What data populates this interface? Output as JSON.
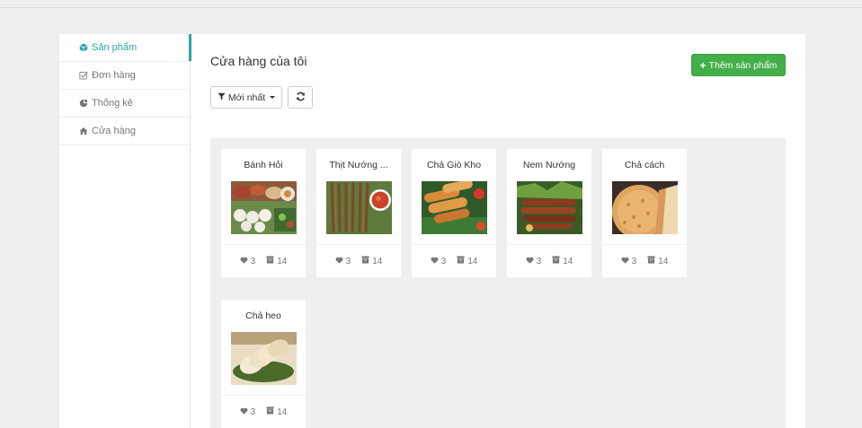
{
  "sidebar": {
    "items": [
      {
        "label": "Sản phẩm",
        "icon": "cube-icon",
        "active": true
      },
      {
        "label": "Đơn hàng",
        "icon": "checkbox-icon",
        "active": false
      },
      {
        "label": "Thống kê",
        "icon": "pie-chart-icon",
        "active": false
      },
      {
        "label": "Cửa hàng",
        "icon": "home-icon",
        "active": false
      }
    ]
  },
  "main": {
    "title": "Cửa hàng của tôi",
    "add_button": "Thêm sản phẩm",
    "filter": {
      "label": "Mới nhất",
      "icon": "filter-icon"
    },
    "refresh_icon": "refresh-icon"
  },
  "products": [
    {
      "name": "Bánh Hỏi",
      "likes": "3",
      "stock": "14"
    },
    {
      "name": "Thịt Nướng ...",
      "likes": "3",
      "stock": "14"
    },
    {
      "name": "Chả Giò Kho",
      "likes": "3",
      "stock": "14"
    },
    {
      "name": "Nem Nướng",
      "likes": "3",
      "stock": "14"
    },
    {
      "name": "Chả cách",
      "likes": "3",
      "stock": "14"
    },
    {
      "name": "Chả heo",
      "likes": "3",
      "stock": "14"
    }
  ],
  "colors": {
    "accent": "#2aa6a0",
    "add_button": "#44ae4a",
    "content_bg": "#efefef"
  }
}
